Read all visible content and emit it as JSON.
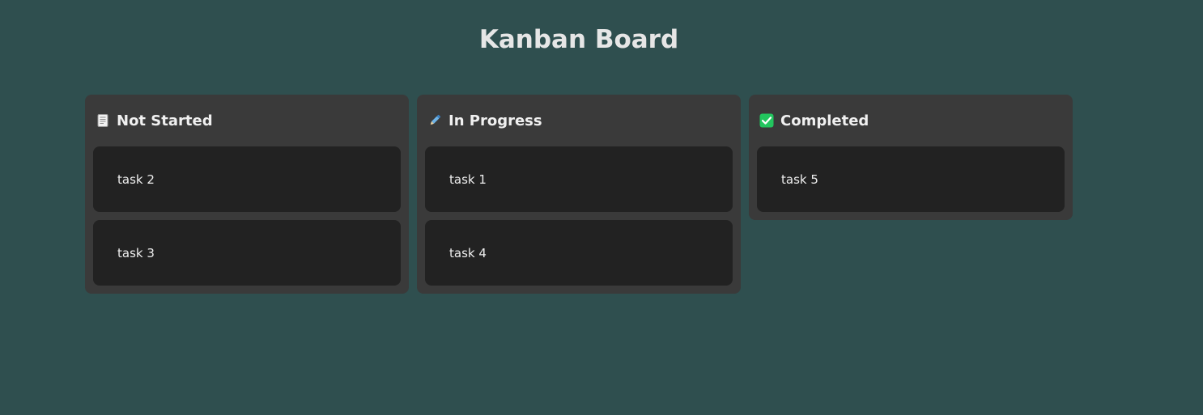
{
  "board": {
    "title": "Kanban Board"
  },
  "columns": [
    {
      "title": "Not Started",
      "icon": "document-page-icon",
      "cards": [
        "task 2",
        "task 3"
      ]
    },
    {
      "title": "In Progress",
      "icon": "pen-icon",
      "cards": [
        "task 1",
        "task 4"
      ]
    },
    {
      "title": "Completed",
      "icon": "check-mark-icon",
      "cards": [
        "task 5"
      ]
    }
  ],
  "colors": {
    "background": "#2f4f4f",
    "column": "#3a3a3a",
    "card": "#222222",
    "check": "#22c55e"
  }
}
